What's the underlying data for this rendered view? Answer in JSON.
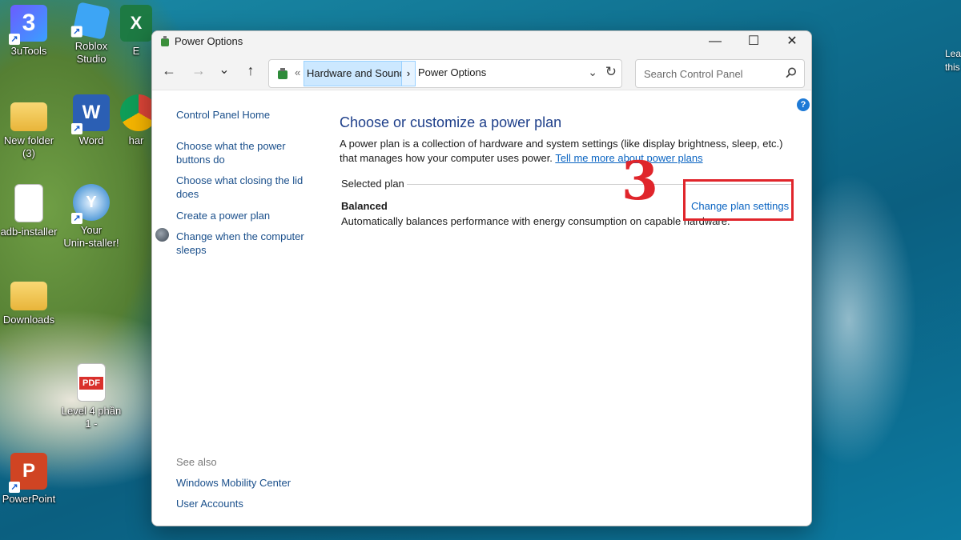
{
  "desktop": {
    "icons": [
      {
        "label": "3uTools"
      },
      {
        "label": "Roblox\nStudio"
      },
      {
        "label": "E"
      },
      {
        "label": "New folder\n(3)"
      },
      {
        "label": "Word"
      },
      {
        "label": "har"
      },
      {
        "label": "adb-installer"
      },
      {
        "label": "Your\nUnin-staller!"
      },
      {
        "label": "Downloads"
      },
      {
        "label": "Level 4 phần\n1 -"
      },
      {
        "label": "PowerPoint"
      }
    ],
    "right_edge": [
      "Lea",
      "this"
    ],
    "pdf_tag": "PDF"
  },
  "window": {
    "title": "Power Options",
    "minimize_glyph": "—",
    "maximize_glyph": "☐",
    "close_glyph": "✕"
  },
  "nav": {
    "back_glyph": "←",
    "forward_glyph": "→",
    "recent_glyph": "⌄",
    "up_glyph": "↑",
    "prefix": "«",
    "breadcrumb_1": "Hardware and Sound",
    "breadcrumb_sep": "›",
    "breadcrumb_2": "Power Options",
    "dropdown_glyph": "⌄",
    "refresh_glyph": "↻"
  },
  "search": {
    "placeholder": "Search Control Panel"
  },
  "sidebar": {
    "home": "Control Panel Home",
    "links": [
      "Choose what the power buttons do",
      "Choose what closing the lid does",
      "Create a power plan",
      "Change when the computer sleeps"
    ],
    "see_also_heading": "See also",
    "see_also": [
      "Windows Mobility Center",
      "User Accounts"
    ]
  },
  "main": {
    "help_glyph": "?",
    "heading": "Choose or customize a power plan",
    "description": "A power plan is a collection of hardware and system settings (like display brightness, sleep, etc.) that manages how your computer uses power.",
    "description_link": "Tell me more about power plans",
    "selected_plan_label": "Selected plan",
    "plan_name": "Balanced",
    "plan_description": "Automatically balances performance with energy consumption on capable hardware.",
    "change_link": "Change plan settings"
  },
  "annotation": {
    "step_number": "3",
    "highlight_color": "#e0252b"
  }
}
